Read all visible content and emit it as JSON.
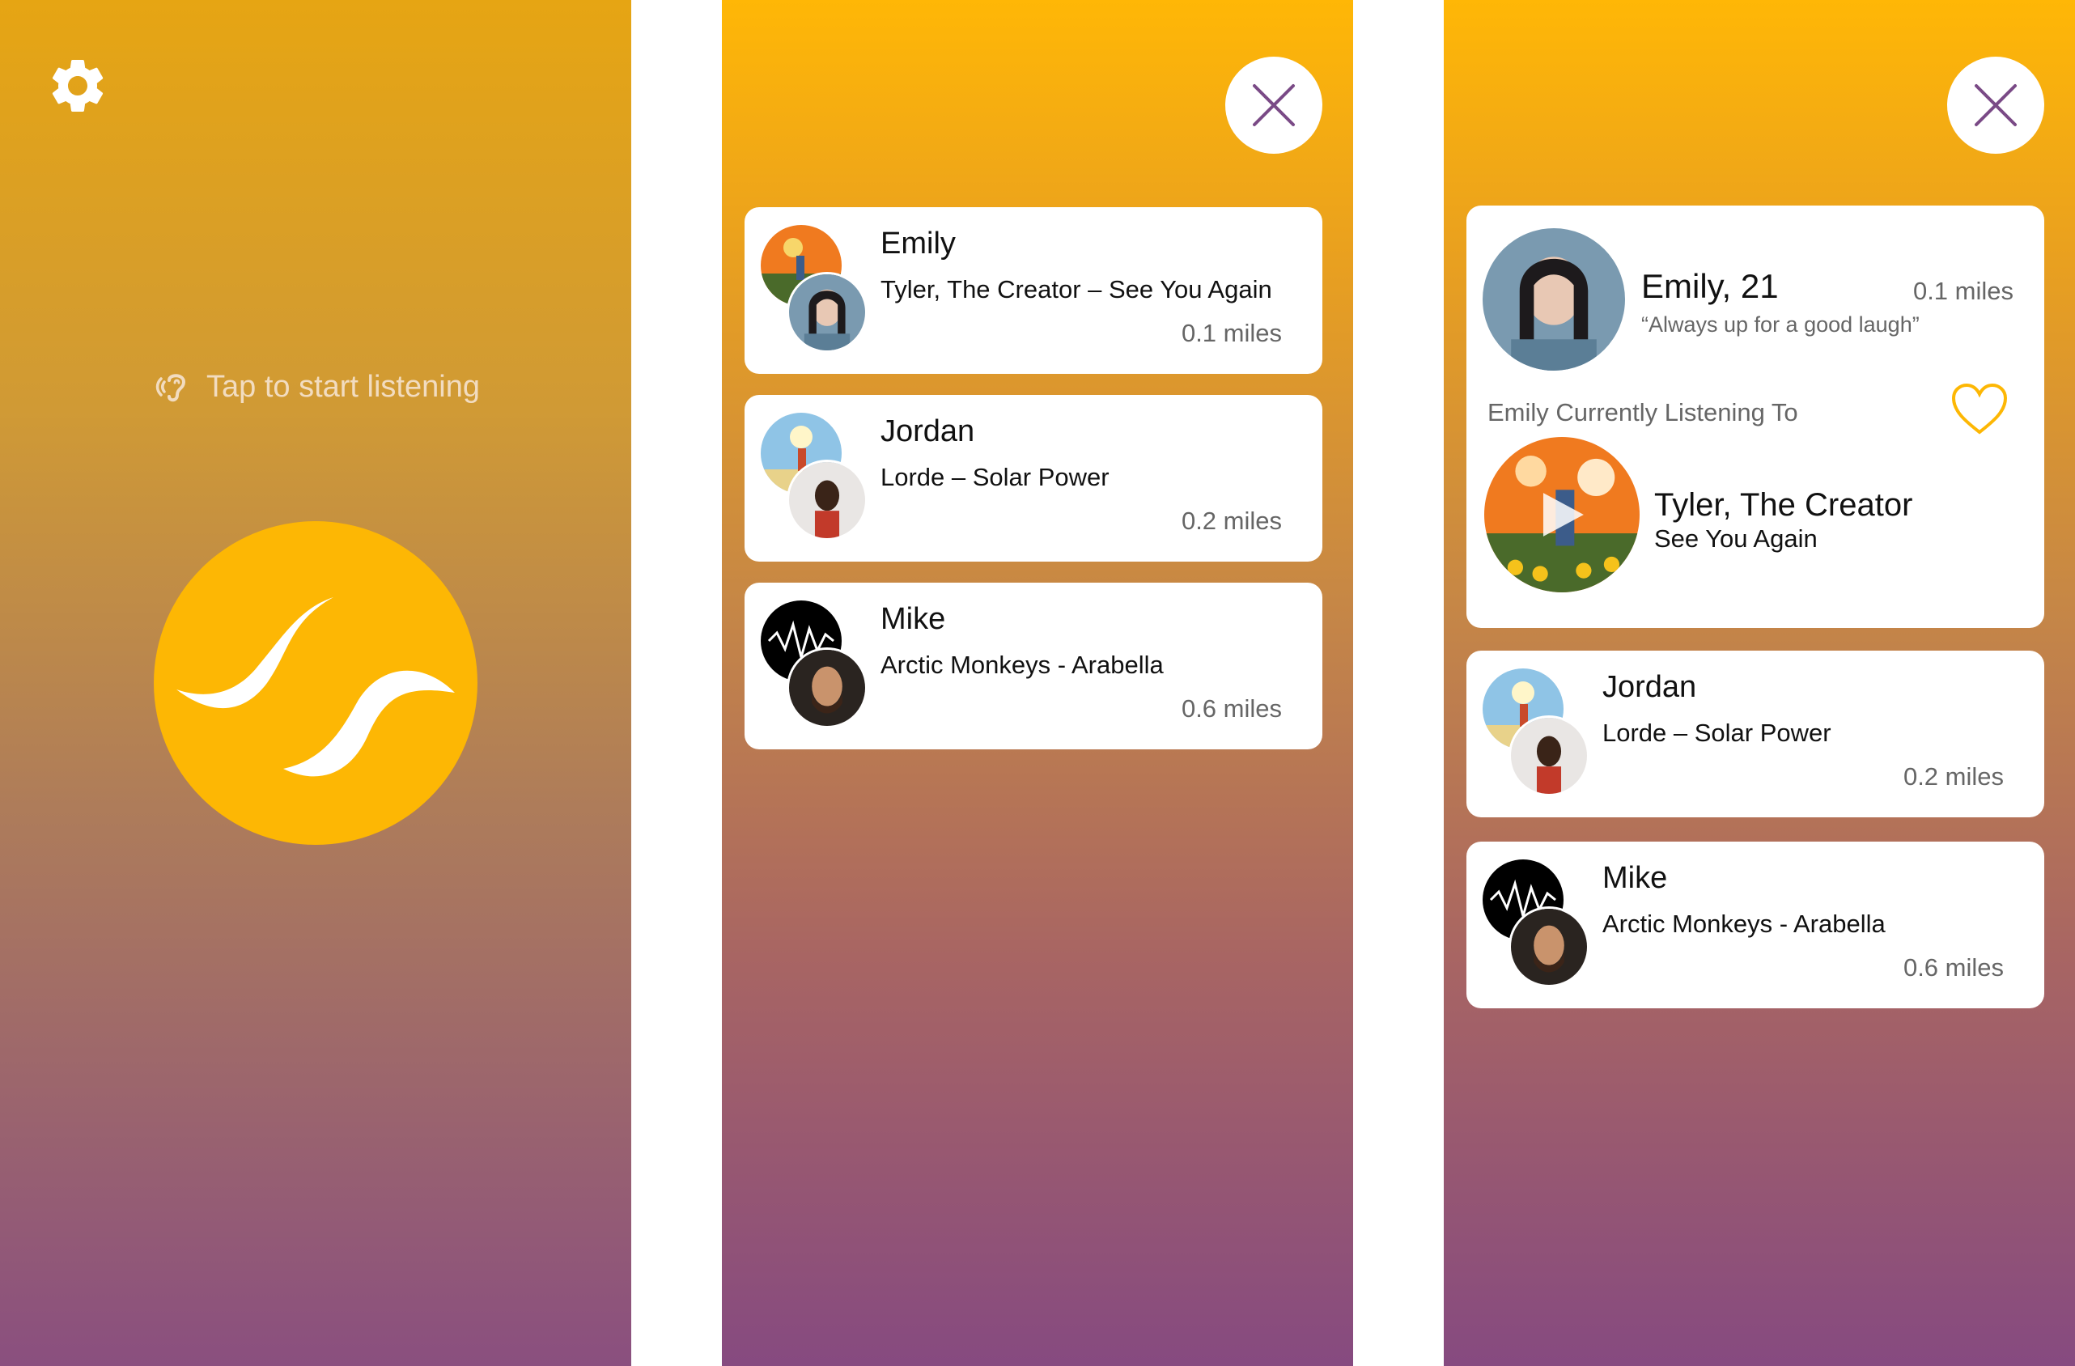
{
  "screen1": {
    "settings_icon": "gear-icon",
    "listen_icon": "ear-listening-icon",
    "tap_text": "Tap to start listening",
    "logo_icon": "wave-logo-icon"
  },
  "screen2": {
    "close_icon": "close-x-icon",
    "users": [
      {
        "name": "Emily",
        "song": "Tyler, The Creator – See You Again",
        "distance": "0.1 miles"
      },
      {
        "name": "Jordan",
        "song": "Lorde – Solar Power",
        "distance": "0.2 miles"
      },
      {
        "name": "Mike",
        "song": "Arctic Monkeys - Arabella",
        "distance": "0.6 miles"
      }
    ]
  },
  "screen3": {
    "close_icon": "close-x-icon",
    "profile": {
      "name_age": "Emily, 21",
      "distance": "0.1 miles",
      "bio": "“Always up for a good laugh”",
      "listening_label": "Emily Currently Listening To",
      "artist": "Tyler, The Creator",
      "track": "See You Again",
      "heart_icon": "heart-outline-icon",
      "play_icon": "play-icon"
    },
    "users": [
      {
        "name": "Jordan",
        "song": "Lorde – Solar Power",
        "distance": "0.2 miles"
      },
      {
        "name": "Mike",
        "song": "Arctic Monkeys - Arabella",
        "distance": "0.6 miles"
      }
    ]
  },
  "colors": {
    "accent_yellow": "#fdb704",
    "close_purple": "#7a4a86",
    "gradient_top": "#e6a513",
    "gradient_bottom": "#8a4f7f"
  }
}
